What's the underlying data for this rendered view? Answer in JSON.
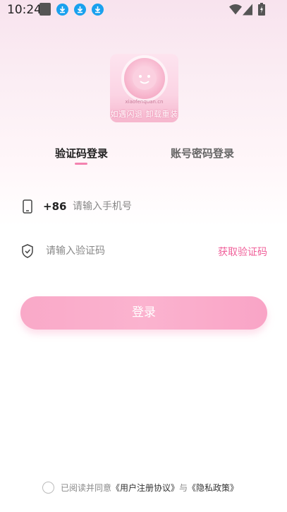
{
  "status_bar": {
    "time": "10:24",
    "icons": [
      "shopping-bag-icon",
      "download-icon",
      "download-icon",
      "download-icon",
      "wifi-icon",
      "signal-icon",
      "battery-charging-icon"
    ]
  },
  "logo": {
    "url_text": "xiaofenquan.cn",
    "slogan": "如遇闪退 卸载重装"
  },
  "tabs": {
    "verification_login": "验证码登录",
    "password_login": "账号密码登录",
    "active": "verification_login"
  },
  "phone": {
    "icon": "phone-icon",
    "prefix": "+86",
    "placeholder": "请输入手机号",
    "value": ""
  },
  "code": {
    "icon": "shield-icon",
    "placeholder": "请输入验证码",
    "value": "",
    "get_code_label": "获取验证码"
  },
  "login_button": {
    "label": "登录"
  },
  "agreement": {
    "prefix": "已阅读并同意",
    "user_agreement": "《用户注册协议》",
    "conjunction": "与",
    "privacy_policy": "《隐私政策》",
    "checked": false
  },
  "colors": {
    "accent": "#f0609a",
    "button": "#fbb3cf",
    "tab_indicator": "#f482b0"
  }
}
